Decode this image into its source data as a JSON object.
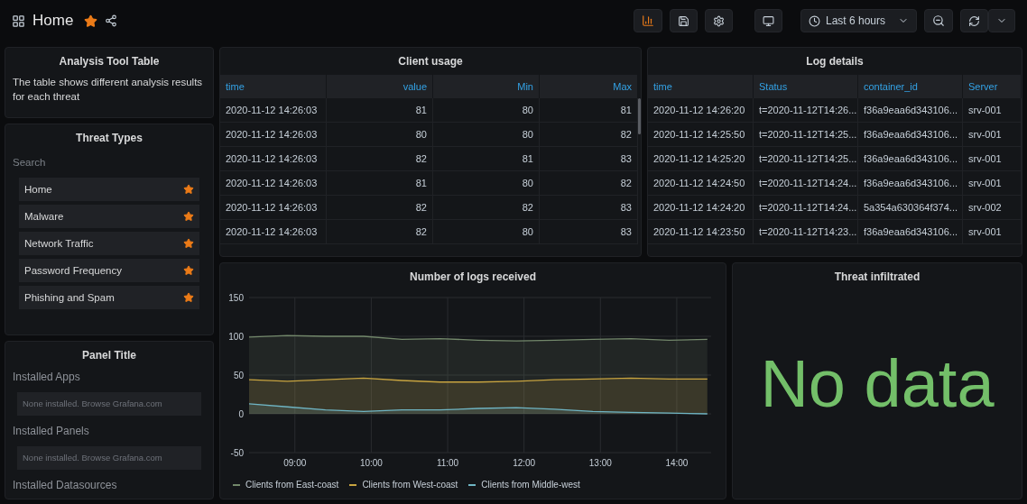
{
  "header": {
    "title": "Home",
    "starred": true,
    "time_range": "Last 6 hours"
  },
  "analysis_panel": {
    "title": "Analysis Tool Table",
    "text": "The table shows different analysis results for each threat"
  },
  "threat_types": {
    "title": "Threat Types",
    "search_placeholder": "Search",
    "items": [
      {
        "label": "Home",
        "starred": true
      },
      {
        "label": "Malware",
        "starred": true
      },
      {
        "label": "Network Traffic",
        "starred": true
      },
      {
        "label": "Password Frequency",
        "starred": true
      },
      {
        "label": "Phishing and Spam",
        "starred": true
      }
    ]
  },
  "plugin_panel": {
    "title": "Panel Title",
    "sections": [
      {
        "heading": "Installed Apps",
        "note": "None installed. Browse Grafana.com"
      },
      {
        "heading": "Installed Panels",
        "note": "None installed. Browse Grafana.com"
      },
      {
        "heading": "Installed Datasources"
      }
    ]
  },
  "client_usage": {
    "title": "Client usage",
    "columns": [
      "time",
      "value",
      "Min",
      "Max"
    ],
    "rows": [
      [
        "2020-11-12 14:26:03",
        "81",
        "80",
        "81"
      ],
      [
        "2020-11-12 14:26:03",
        "80",
        "80",
        "82"
      ],
      [
        "2020-11-12 14:26:03",
        "82",
        "81",
        "83"
      ],
      [
        "2020-11-12 14:26:03",
        "81",
        "80",
        "82"
      ],
      [
        "2020-11-12 14:26:03",
        "82",
        "82",
        "83"
      ],
      [
        "2020-11-12 14:26:03",
        "82",
        "80",
        "83"
      ]
    ]
  },
  "log_details": {
    "title": "Log details",
    "columns": [
      "time",
      "Status",
      "container_id",
      "Server"
    ],
    "rows": [
      [
        "2020-11-12 14:26:20",
        "t=2020-11-12T14:26...",
        "f36a9eaa6d343106...",
        "srv-001"
      ],
      [
        "2020-11-12 14:25:50",
        "t=2020-11-12T14:25...",
        "f36a9eaa6d343106...",
        "srv-001"
      ],
      [
        "2020-11-12 14:25:20",
        "t=2020-11-12T14:25...",
        "f36a9eaa6d343106...",
        "srv-001"
      ],
      [
        "2020-11-12 14:24:50",
        "t=2020-11-12T14:24...",
        "f36a9eaa6d343106...",
        "srv-001"
      ],
      [
        "2020-11-12 14:24:20",
        "t=2020-11-12T14:24...",
        "5a354a630364f374...",
        "srv-002"
      ],
      [
        "2020-11-12 14:23:50",
        "t=2020-11-12T14:23...",
        "f36a9eaa6d343106...",
        "srv-001"
      ]
    ]
  },
  "logs_chart": {
    "title": "Number of logs received",
    "chart_data": {
      "type": "area",
      "x": [
        8.4,
        8.9,
        9.4,
        9.9,
        10.4,
        10.9,
        11.4,
        11.9,
        12.4,
        12.9,
        13.4,
        13.9,
        14.4
      ],
      "series": [
        {
          "name": "Clients from East-coast",
          "color": "#73886b",
          "values": [
            99,
            101,
            100,
            100,
            96,
            97,
            95,
            94,
            95,
            96,
            97,
            95,
            96
          ]
        },
        {
          "name": "Clients from West-coast",
          "color": "#c8a440",
          "values": [
            44,
            42,
            44,
            46,
            43,
            41,
            41,
            42,
            44,
            45,
            46,
            45,
            45
          ]
        },
        {
          "name": "Clients from Middle-west",
          "color": "#6fb5c4",
          "values": [
            13,
            9,
            5,
            3,
            5,
            5,
            7,
            8,
            6,
            3,
            2,
            1,
            0
          ]
        }
      ],
      "xlim": [
        8.4,
        14.45
      ],
      "ylim": [
        -50,
        150
      ],
      "xticks": [
        {
          "value": 9,
          "label": "09:00"
        },
        {
          "value": 10,
          "label": "10:00"
        },
        {
          "value": 11,
          "label": "11:00"
        },
        {
          "value": 12,
          "label": "12:00"
        },
        {
          "value": 13,
          "label": "13:00"
        },
        {
          "value": 14,
          "label": "14:00"
        }
      ],
      "yticks": [
        150,
        100,
        50,
        0,
        -50
      ],
      "grid": true
    }
  },
  "threat_panel": {
    "title": "Threat infiltrated",
    "value": "No data"
  }
}
